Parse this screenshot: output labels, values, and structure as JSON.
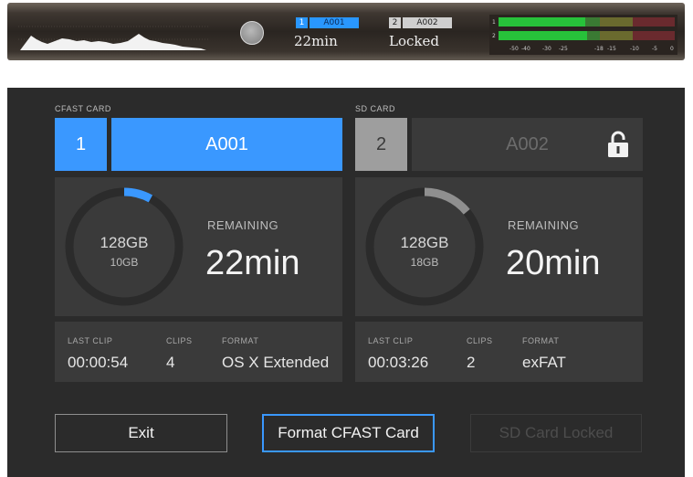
{
  "statusbar": {
    "slot1": {
      "number": "1",
      "name": "A001",
      "value": "22min"
    },
    "slot2": {
      "number": "2",
      "name": "A002",
      "value": "Locked"
    },
    "meter_scale": [
      "-50",
      "-40",
      "-30",
      "-25",
      "-18",
      "-15",
      "-10",
      "-5",
      "0"
    ],
    "meter_channels": [
      "1",
      "2"
    ]
  },
  "cards": [
    {
      "type_label": "CFAST CARD",
      "number": "1",
      "name": "A001",
      "total": "128GB",
      "used": "10GB",
      "fill_fraction": 0.08,
      "remaining_label": "REMAINING",
      "remaining": "22min",
      "last_clip_label": "LAST CLIP",
      "last_clip": "00:00:54",
      "clips_label": "CLIPS",
      "clips": "4",
      "format_label": "FORMAT",
      "format": "OS X Extended",
      "color": "#3a98ff"
    },
    {
      "type_label": "SD CARD",
      "number": "2",
      "name": "A002",
      "total": "128GB",
      "used": "18GB",
      "fill_fraction": 0.14,
      "remaining_label": "REMAINING",
      "remaining": "20min",
      "last_clip_label": "LAST CLIP",
      "last_clip": "00:03:26",
      "clips_label": "CLIPS",
      "clips": "2",
      "format_label": "FORMAT",
      "format": "exFAT",
      "color": "#8f8f8f",
      "locked_icon": "padlock-icon"
    }
  ],
  "buttons": {
    "exit": "Exit",
    "format": "Format CFAST Card",
    "sd_locked": "SD Card Locked"
  }
}
